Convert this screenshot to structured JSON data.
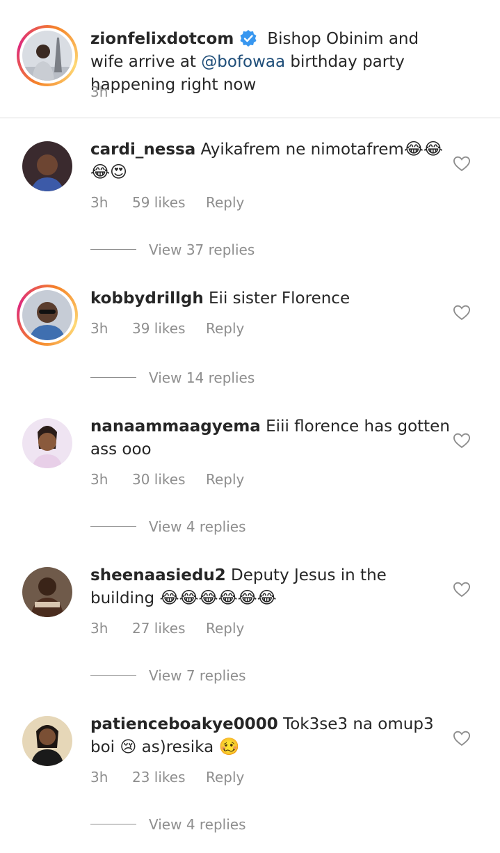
{
  "post": {
    "username": "zionfelixdotcom",
    "verified_icon": "verified-badge-icon",
    "caption_part1": "Bishop Obinim and wife arrive at",
    "mention": "@bofowaa",
    "caption_part2": "birthday party happening right now",
    "time": "3h"
  },
  "comments": [
    {
      "username": "cardi_nessa",
      "text": "Ayikafrem ne nimotafrem",
      "emoji": "😂😂😂😍",
      "time": "3h",
      "likes": "59 likes",
      "reply_label": "Reply",
      "view_replies": "View 37 replies"
    },
    {
      "username": "kobbydrillgh",
      "text": "Eii sister Florence",
      "emoji": "",
      "time": "3h",
      "likes": "39 likes",
      "reply_label": "Reply",
      "view_replies": "View 14 replies"
    },
    {
      "username": "nanaammaagyema",
      "text": "Eiii florence has gotten ass ooo",
      "emoji": "",
      "time": "3h",
      "likes": "30 likes",
      "reply_label": "Reply",
      "view_replies": "View 4 replies"
    },
    {
      "username": "sheenaasiedu2",
      "text": "Deputy Jesus in the building",
      "emoji": "😂😂😂😂😂😂",
      "time": "3h",
      "likes": "27 likes",
      "reply_label": "Reply",
      "view_replies": "View 7 replies"
    },
    {
      "username": "patienceboakye0000",
      "text": "Tok3se3 na omup3 boi 😢 as)resika",
      "emoji": "🥴",
      "time": "3h",
      "likes": "23 likes",
      "reply_label": "Reply",
      "view_replies": "View 4 replies"
    }
  ],
  "colors": {
    "text": "#262626",
    "muted": "#8e8e8e",
    "mention": "#1f4e79",
    "verified": "#3897f0",
    "divider": "#dbdbdb"
  }
}
